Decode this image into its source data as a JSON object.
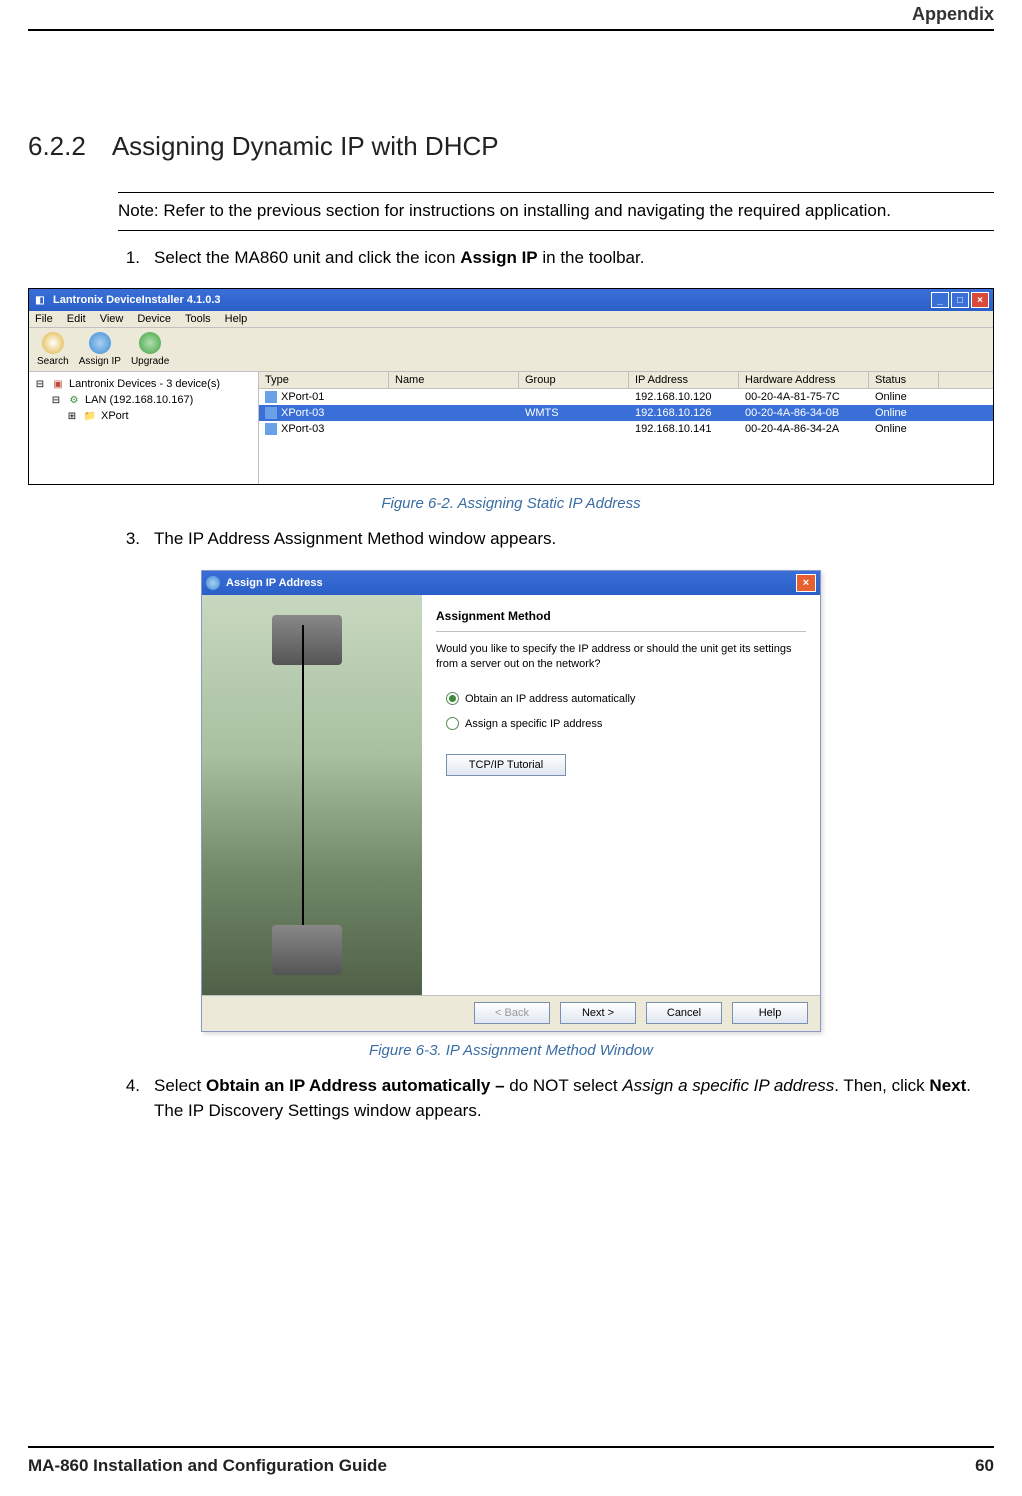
{
  "header_right": "Appendix",
  "section_number": "6.2.2",
  "section_title": "Assigning Dynamic IP with DHCP",
  "note_text": "Note: Refer to the previous section for instructions on installing and navigating the required application.",
  "step1_num": "1.",
  "step1_a": "Select the MA860 unit and click the icon ",
  "step1_b": "Assign IP",
  "step1_c": " in the toolbar.",
  "caption_6_2": "Figure 6-2. Assigning Static IP Address",
  "step3_num": "3.",
  "step3_text": "The IP Address Assignment Method window appears.",
  "caption_6_3": "Figure 6-3. IP Assignment Method Window",
  "step4_num": "4.",
  "step4_a": "Select ",
  "step4_b": "Obtain an IP Address automatically – ",
  "step4_c": "do NOT select ",
  "step4_d": "Assign a specific IP address",
  "step4_e": ". Then, click ",
  "step4_f": "Next",
  "step4_g": ". The IP Discovery Settings window appears.",
  "footer_left": "MA-860 Installation and Configuration Guide",
  "footer_right": "60",
  "di": {
    "title": "Lantronix DeviceInstaller 4.1.0.3",
    "menus": [
      "File",
      "Edit",
      "View",
      "Device",
      "Tools",
      "Help"
    ],
    "toolbar": [
      {
        "label": "Search",
        "color": "#e0b030"
      },
      {
        "label": "Assign IP",
        "color": "#3a8ad8"
      },
      {
        "label": "Upgrade",
        "color": "#40a040"
      }
    ],
    "tree_root": "Lantronix Devices - 3 device(s)",
    "tree_lan": "LAN (192.168.10.167)",
    "tree_xport": "XPort",
    "cols": [
      "Type",
      "Name",
      "Group",
      "IP Address",
      "Hardware Address",
      "Status"
    ],
    "rows": [
      {
        "type": "XPort-01",
        "name": "",
        "group": "",
        "ip": "192.168.10.120",
        "hw": "00-20-4A-81-75-7C",
        "status": "Online",
        "sel": false
      },
      {
        "type": "XPort-03",
        "name": "",
        "group": "WMTS",
        "ip": "192.168.10.126",
        "hw": "00-20-4A-86-34-0B",
        "status": "Online",
        "sel": true
      },
      {
        "type": "XPort-03",
        "name": "",
        "group": "",
        "ip": "192.168.10.141",
        "hw": "00-20-4A-86-34-2A",
        "status": "Online",
        "sel": false
      }
    ]
  },
  "dlg": {
    "title": "Assign IP Address",
    "heading": "Assignment Method",
    "prompt": "Would you like to specify the IP address or should the unit get its settings from a server out on the network?",
    "opt1": "Obtain an IP address automatically",
    "opt2": "Assign a specific IP address",
    "tutorial": "TCP/IP Tutorial",
    "back": "< Back",
    "next": "Next >",
    "cancel": "Cancel",
    "help": "Help"
  }
}
